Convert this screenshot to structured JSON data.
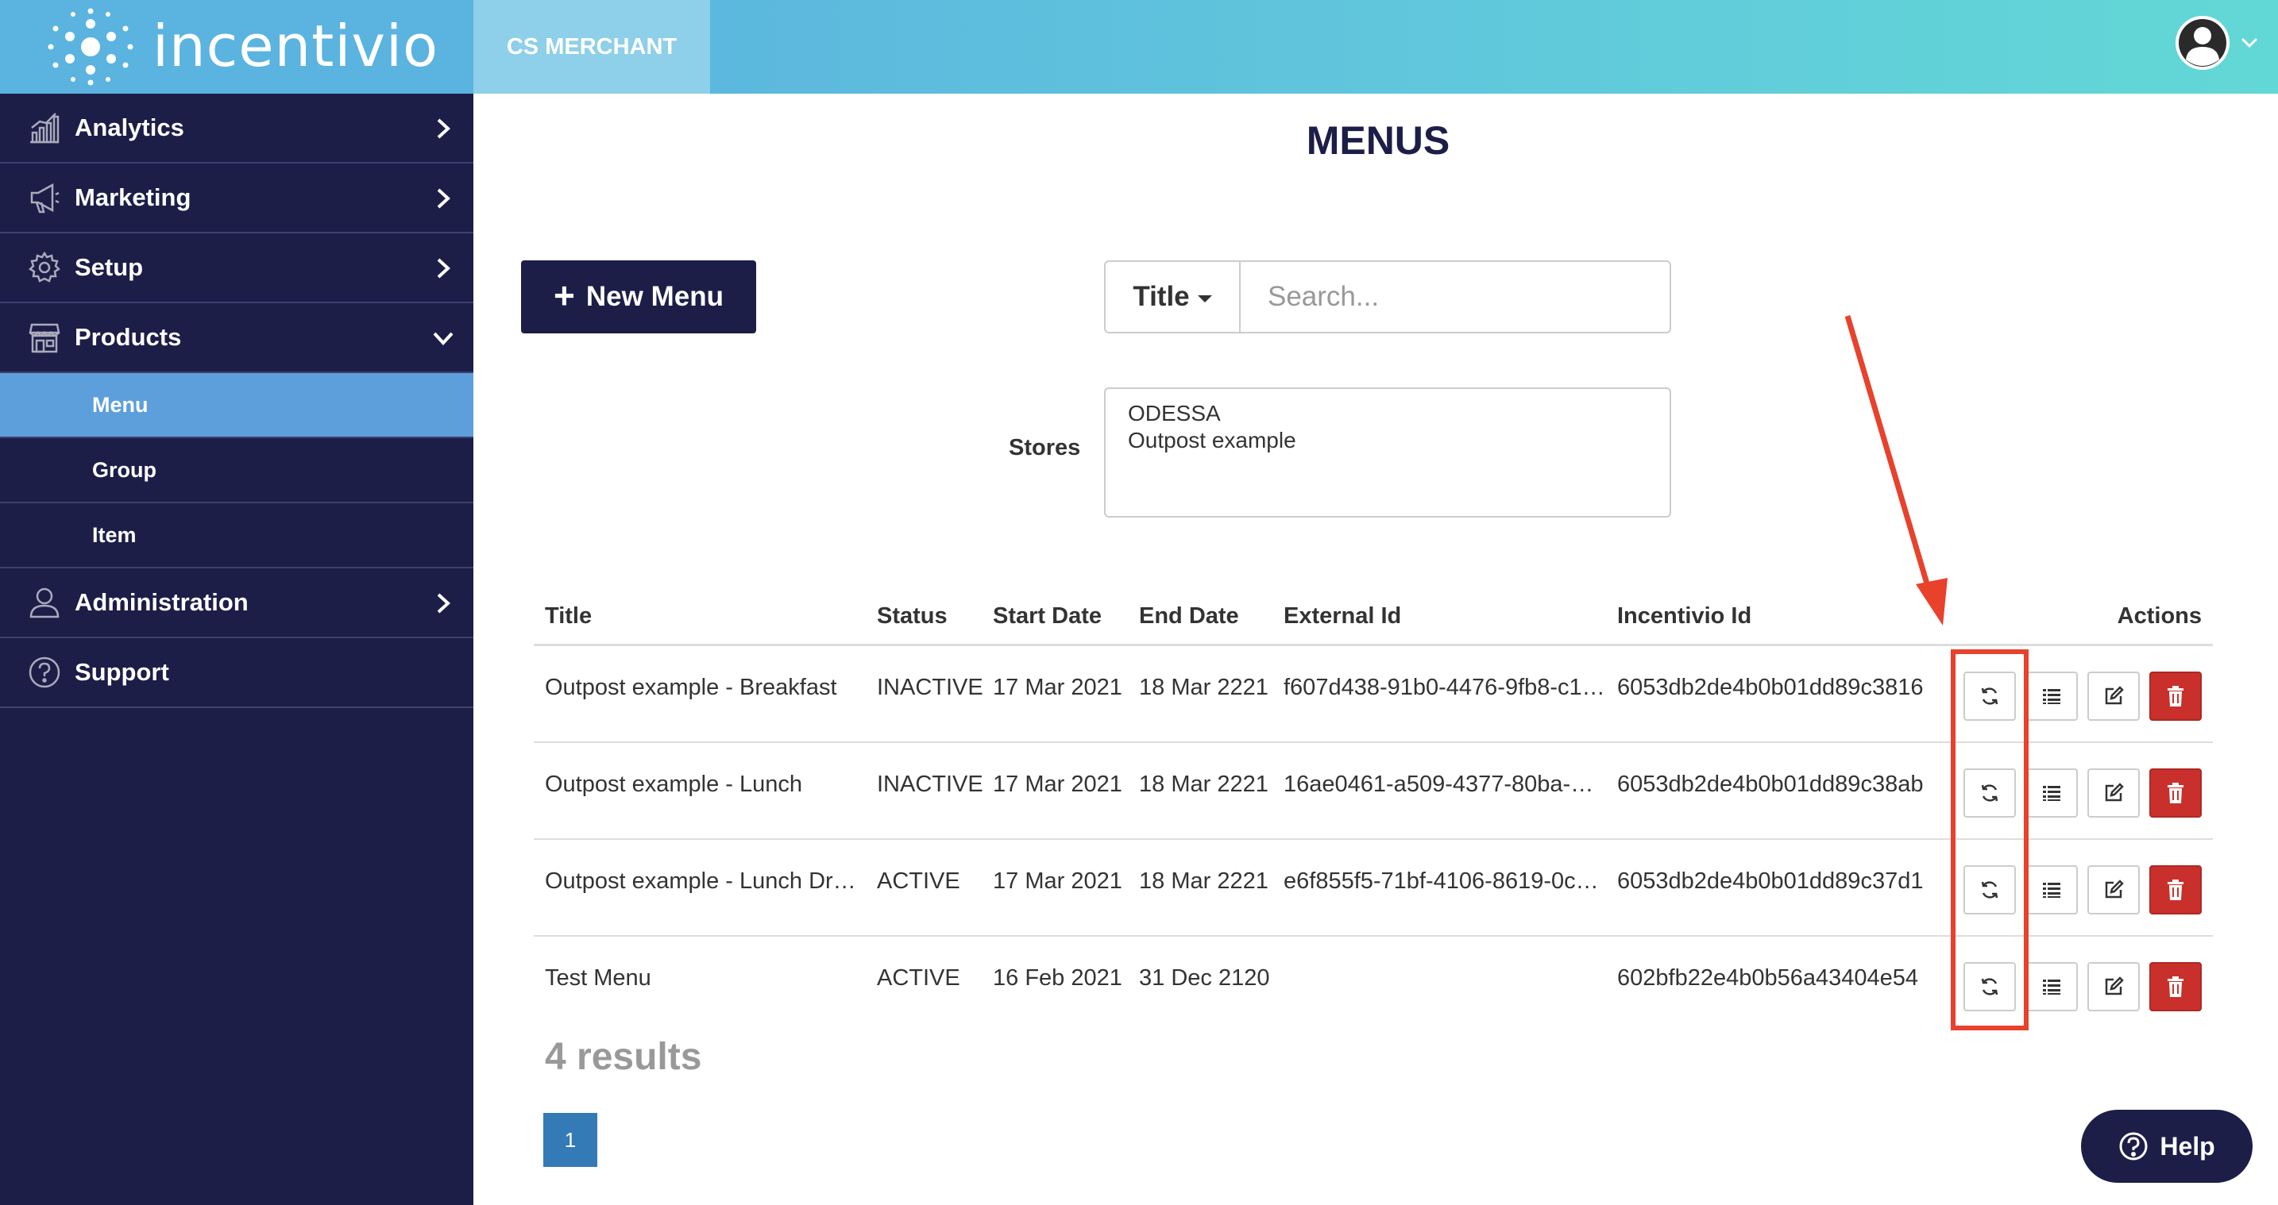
{
  "brand": {
    "logo_text": "incentivio"
  },
  "topbar": {
    "merchant": "CS MERCHANT"
  },
  "sidebar": {
    "items": [
      {
        "label": "Analytics"
      },
      {
        "label": "Marketing"
      },
      {
        "label": "Setup"
      },
      {
        "label": "Products"
      },
      {
        "label": "Administration"
      },
      {
        "label": "Support"
      }
    ],
    "products_sub": [
      {
        "label": "Menu",
        "active": true
      },
      {
        "label": "Group"
      },
      {
        "label": "Item"
      }
    ]
  },
  "page": {
    "title": "MENUS"
  },
  "toolbar": {
    "new_menu_label": "New Menu",
    "search_field": "Title",
    "search_placeholder": "Search...",
    "stores_label": "Stores",
    "stores": [
      "ODESSA",
      "Outpost example"
    ]
  },
  "table": {
    "headers": {
      "title": "Title",
      "status": "Status",
      "start": "Start Date",
      "end": "End Date",
      "external": "External Id",
      "incentivio": "Incentivio Id",
      "actions": "Actions"
    },
    "rows": [
      {
        "title": "Outpost example - Breakfast",
        "status": "INACTIVE",
        "start": "17 Mar 2021",
        "end": "18 Mar 2221",
        "external": "f607d438-91b0-4476-9fb8-c1…",
        "incentivio": "6053db2de4b0b01dd89c3816"
      },
      {
        "title": "Outpost example - Lunch",
        "status": "INACTIVE",
        "start": "17 Mar 2021",
        "end": "18 Mar 2221",
        "external": "16ae0461-a509-4377-80ba-8…",
        "incentivio": "6053db2de4b0b01dd89c38ab"
      },
      {
        "title": "Outpost example - Lunch Dro…",
        "status": "ACTIVE",
        "start": "17 Mar 2021",
        "end": "18 Mar 2221",
        "external": "e6f855f5-71bf-4106-8619-0c…",
        "incentivio": "6053db2de4b0b01dd89c37d1"
      },
      {
        "title": "Test Menu",
        "status": "ACTIVE",
        "start": "16 Feb 2021",
        "end": "31 Dec 2120",
        "external": "",
        "incentivio": "602bfb22e4b0b56a43404e54"
      }
    ]
  },
  "results": "4 results",
  "pagination": {
    "current": "1"
  },
  "help": {
    "label": "Help"
  },
  "colors": {
    "sidebar_bg": "#1c1e48",
    "active_item": "#5c9fdb",
    "delete": "#c9302c",
    "annotation": "#e8412c"
  }
}
